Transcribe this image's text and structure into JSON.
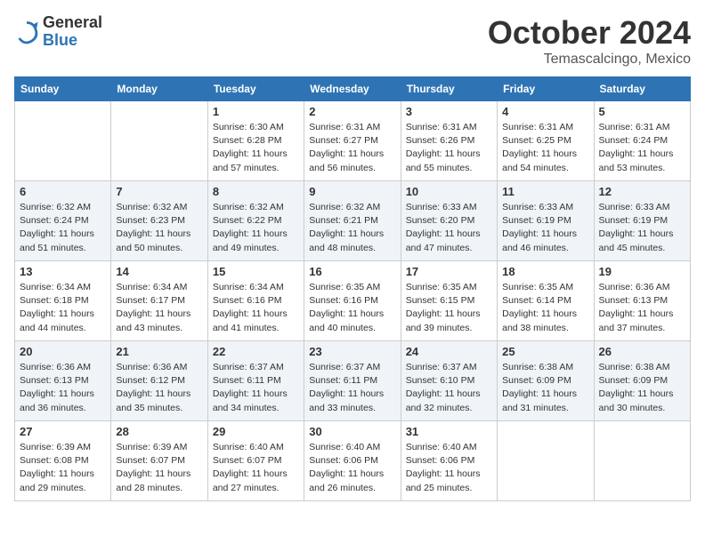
{
  "logo": {
    "general": "General",
    "blue": "Blue"
  },
  "title": "October 2024",
  "subtitle": "Temascalcingo, Mexico",
  "days": [
    "Sunday",
    "Monday",
    "Tuesday",
    "Wednesday",
    "Thursday",
    "Friday",
    "Saturday"
  ],
  "weeks": [
    [
      {
        "day": "",
        "info": ""
      },
      {
        "day": "",
        "info": ""
      },
      {
        "day": "1",
        "info": "Sunrise: 6:30 AM\nSunset: 6:28 PM\nDaylight: 11 hours and 57 minutes."
      },
      {
        "day": "2",
        "info": "Sunrise: 6:31 AM\nSunset: 6:27 PM\nDaylight: 11 hours and 56 minutes."
      },
      {
        "day": "3",
        "info": "Sunrise: 6:31 AM\nSunset: 6:26 PM\nDaylight: 11 hours and 55 minutes."
      },
      {
        "day": "4",
        "info": "Sunrise: 6:31 AM\nSunset: 6:25 PM\nDaylight: 11 hours and 54 minutes."
      },
      {
        "day": "5",
        "info": "Sunrise: 6:31 AM\nSunset: 6:24 PM\nDaylight: 11 hours and 53 minutes."
      }
    ],
    [
      {
        "day": "6",
        "info": "Sunrise: 6:32 AM\nSunset: 6:24 PM\nDaylight: 11 hours and 51 minutes."
      },
      {
        "day": "7",
        "info": "Sunrise: 6:32 AM\nSunset: 6:23 PM\nDaylight: 11 hours and 50 minutes."
      },
      {
        "day": "8",
        "info": "Sunrise: 6:32 AM\nSunset: 6:22 PM\nDaylight: 11 hours and 49 minutes."
      },
      {
        "day": "9",
        "info": "Sunrise: 6:32 AM\nSunset: 6:21 PM\nDaylight: 11 hours and 48 minutes."
      },
      {
        "day": "10",
        "info": "Sunrise: 6:33 AM\nSunset: 6:20 PM\nDaylight: 11 hours and 47 minutes."
      },
      {
        "day": "11",
        "info": "Sunrise: 6:33 AM\nSunset: 6:19 PM\nDaylight: 11 hours and 46 minutes."
      },
      {
        "day": "12",
        "info": "Sunrise: 6:33 AM\nSunset: 6:19 PM\nDaylight: 11 hours and 45 minutes."
      }
    ],
    [
      {
        "day": "13",
        "info": "Sunrise: 6:34 AM\nSunset: 6:18 PM\nDaylight: 11 hours and 44 minutes."
      },
      {
        "day": "14",
        "info": "Sunrise: 6:34 AM\nSunset: 6:17 PM\nDaylight: 11 hours and 43 minutes."
      },
      {
        "day": "15",
        "info": "Sunrise: 6:34 AM\nSunset: 6:16 PM\nDaylight: 11 hours and 41 minutes."
      },
      {
        "day": "16",
        "info": "Sunrise: 6:35 AM\nSunset: 6:16 PM\nDaylight: 11 hours and 40 minutes."
      },
      {
        "day": "17",
        "info": "Sunrise: 6:35 AM\nSunset: 6:15 PM\nDaylight: 11 hours and 39 minutes."
      },
      {
        "day": "18",
        "info": "Sunrise: 6:35 AM\nSunset: 6:14 PM\nDaylight: 11 hours and 38 minutes."
      },
      {
        "day": "19",
        "info": "Sunrise: 6:36 AM\nSunset: 6:13 PM\nDaylight: 11 hours and 37 minutes."
      }
    ],
    [
      {
        "day": "20",
        "info": "Sunrise: 6:36 AM\nSunset: 6:13 PM\nDaylight: 11 hours and 36 minutes."
      },
      {
        "day": "21",
        "info": "Sunrise: 6:36 AM\nSunset: 6:12 PM\nDaylight: 11 hours and 35 minutes."
      },
      {
        "day": "22",
        "info": "Sunrise: 6:37 AM\nSunset: 6:11 PM\nDaylight: 11 hours and 34 minutes."
      },
      {
        "day": "23",
        "info": "Sunrise: 6:37 AM\nSunset: 6:11 PM\nDaylight: 11 hours and 33 minutes."
      },
      {
        "day": "24",
        "info": "Sunrise: 6:37 AM\nSunset: 6:10 PM\nDaylight: 11 hours and 32 minutes."
      },
      {
        "day": "25",
        "info": "Sunrise: 6:38 AM\nSunset: 6:09 PM\nDaylight: 11 hours and 31 minutes."
      },
      {
        "day": "26",
        "info": "Sunrise: 6:38 AM\nSunset: 6:09 PM\nDaylight: 11 hours and 30 minutes."
      }
    ],
    [
      {
        "day": "27",
        "info": "Sunrise: 6:39 AM\nSunset: 6:08 PM\nDaylight: 11 hours and 29 minutes."
      },
      {
        "day": "28",
        "info": "Sunrise: 6:39 AM\nSunset: 6:07 PM\nDaylight: 11 hours and 28 minutes."
      },
      {
        "day": "29",
        "info": "Sunrise: 6:40 AM\nSunset: 6:07 PM\nDaylight: 11 hours and 27 minutes."
      },
      {
        "day": "30",
        "info": "Sunrise: 6:40 AM\nSunset: 6:06 PM\nDaylight: 11 hours and 26 minutes."
      },
      {
        "day": "31",
        "info": "Sunrise: 6:40 AM\nSunset: 6:06 PM\nDaylight: 11 hours and 25 minutes."
      },
      {
        "day": "",
        "info": ""
      },
      {
        "day": "",
        "info": ""
      }
    ]
  ]
}
